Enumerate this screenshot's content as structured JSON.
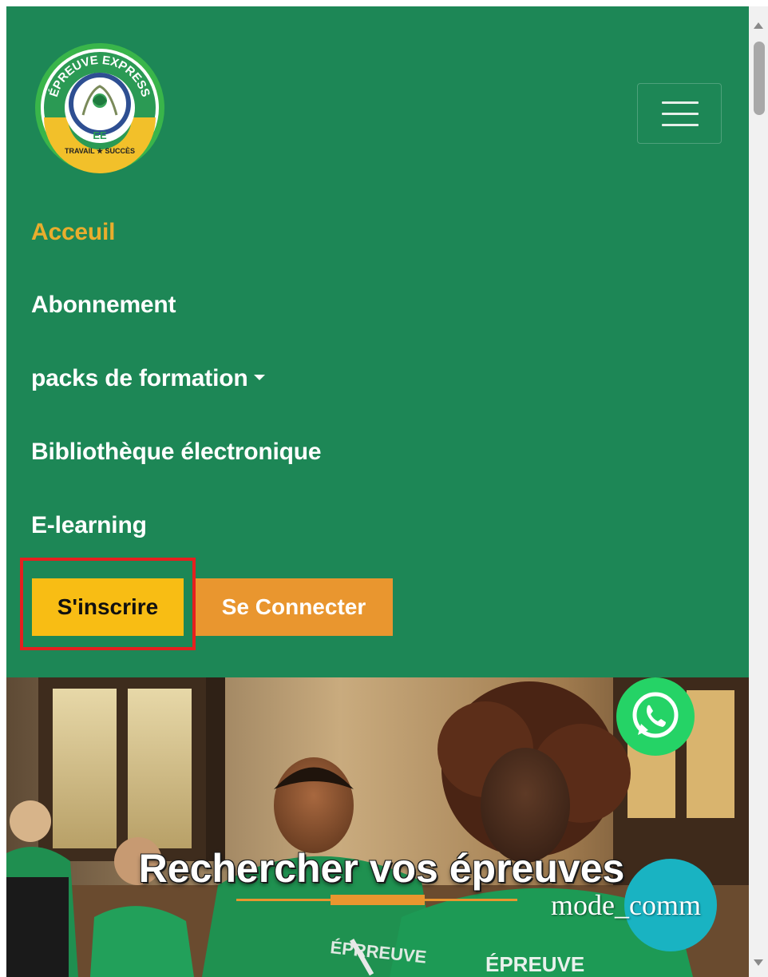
{
  "brand": {
    "logo_top_text": "ÉPREUVE EXPRESS",
    "logo_initials": "EE",
    "logo_bottom_text": "TRAVAIL ★ SUCCÈS",
    "logo_icon": "laurel-wreath-logo"
  },
  "navbar": {
    "toggler_icon": "hamburger-icon",
    "items": [
      {
        "label": "Acceuil",
        "active": true
      },
      {
        "label": "Abonnement"
      },
      {
        "label": "packs de formation",
        "dropdown": true
      },
      {
        "label": "Bibliothèque électronique"
      },
      {
        "label": "E-learning"
      }
    ],
    "register_label": "S'inscrire",
    "login_label": "Se Connecter"
  },
  "hero": {
    "title": "Rechercher vos épreuves",
    "mode_text": "mode_comm",
    "whatsapp_icon": "whatsapp-icon",
    "shirt_text": "ÉPRREUVE",
    "shirt_text_2": "ÉPREUVE"
  },
  "colors": {
    "navbar_bg": "#1d8756",
    "active_link": "#e9ad2d",
    "register_bg": "#f8bd14",
    "login_bg": "#e9962f",
    "highlight_border": "#e5201f",
    "whatsapp_green": "#25d366",
    "accent_teal": "#19b3c2"
  }
}
